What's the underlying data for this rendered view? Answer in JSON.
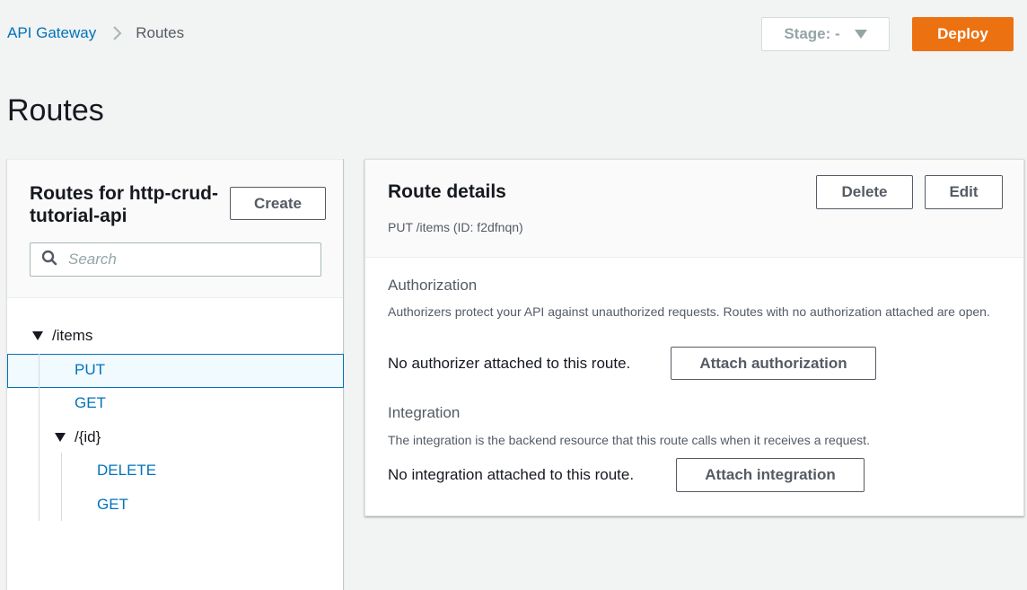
{
  "breadcrumb": {
    "items": [
      {
        "label": "API Gateway",
        "link": true
      },
      {
        "label": "Routes",
        "link": false
      }
    ],
    "separator_icon": "chevron-right-icon"
  },
  "toolbar": {
    "stage_label": "Stage: -",
    "deploy_label": "Deploy",
    "deploy_color": "#ec7211"
  },
  "page": {
    "title": "Routes"
  },
  "routes_panel": {
    "title": "Routes for http-crud-tutorial-api",
    "create_label": "Create",
    "search_placeholder": "Search",
    "search_value": "",
    "tree": {
      "root": {
        "path": "/items",
        "expanded": true,
        "methods": [
          "PUT",
          "GET"
        ],
        "children": [
          {
            "path": "/{id}",
            "expanded": true,
            "methods": [
              "DELETE",
              "GET"
            ]
          }
        ]
      },
      "selected": "PUT /items"
    }
  },
  "details_panel": {
    "title": "Route details",
    "delete_label": "Delete",
    "edit_label": "Edit",
    "route_summary": "PUT /items (ID: f2dfnqn)",
    "authorization": {
      "title": "Authorization",
      "description": "Authorizers protect your API against unauthorized requests. Routes with no authorization attached are open.",
      "status": "No authorizer attached to this route.",
      "button_label": "Attach authorization"
    },
    "integration": {
      "title": "Integration",
      "description": "The integration is the backend resource that this route calls when it receives a request.",
      "status": "No integration attached to this route.",
      "button_label": "Attach integration"
    }
  },
  "colors": {
    "link": "#0073bb",
    "selected_bg": "#f1faff",
    "page_bg": "#f2f3f3"
  }
}
